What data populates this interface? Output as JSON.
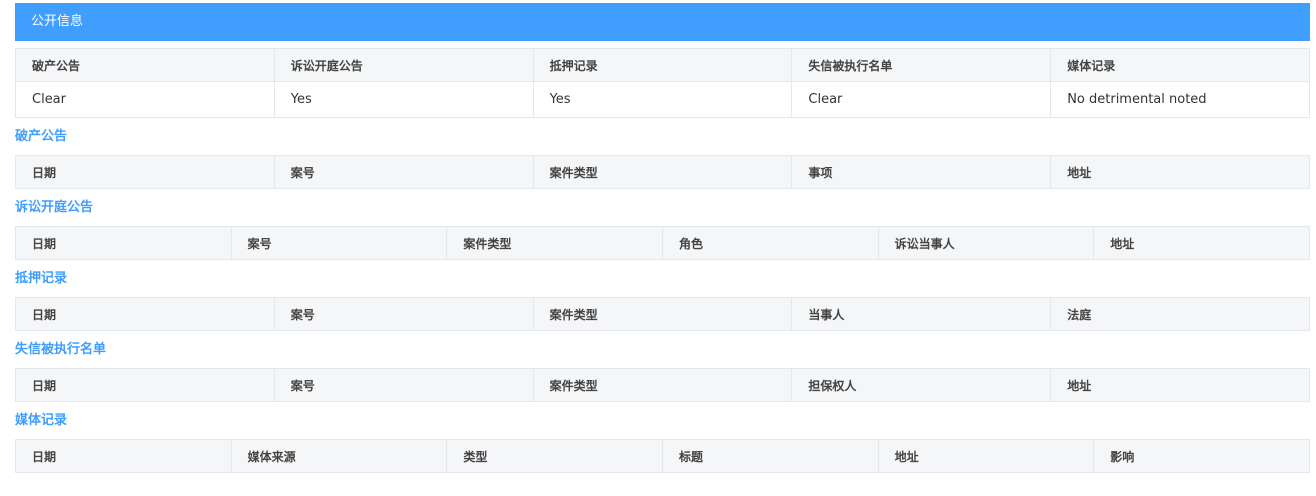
{
  "banner_title": "公开信息",
  "summary": {
    "headers": [
      "破产公告",
      "诉讼开庭公告",
      "抵押记录",
      "失信被执行名单",
      "媒体记录"
    ],
    "values": [
      "Clear",
      "Yes",
      "Yes",
      "Clear",
      "No detrimental noted"
    ]
  },
  "sections": [
    {
      "title": "破产公告",
      "headers": [
        "日期",
        "案号",
        "案件类型",
        "事项",
        "地址"
      ]
    },
    {
      "title": "诉讼开庭公告",
      "headers": [
        "日期",
        "案号",
        "案件类型",
        "角色",
        "诉讼当事人",
        "地址"
      ]
    },
    {
      "title": "抵押记录",
      "headers": [
        "日期",
        "案号",
        "案件类型",
        "当事人",
        "法庭"
      ]
    },
    {
      "title": "失信被执行名单",
      "headers": [
        "日期",
        "案号",
        "案件类型",
        "担保权人",
        "地址"
      ]
    },
    {
      "title": "媒体记录",
      "headers": [
        "日期",
        "媒体来源",
        "类型",
        "标题",
        "地址",
        "影响"
      ]
    }
  ]
}
